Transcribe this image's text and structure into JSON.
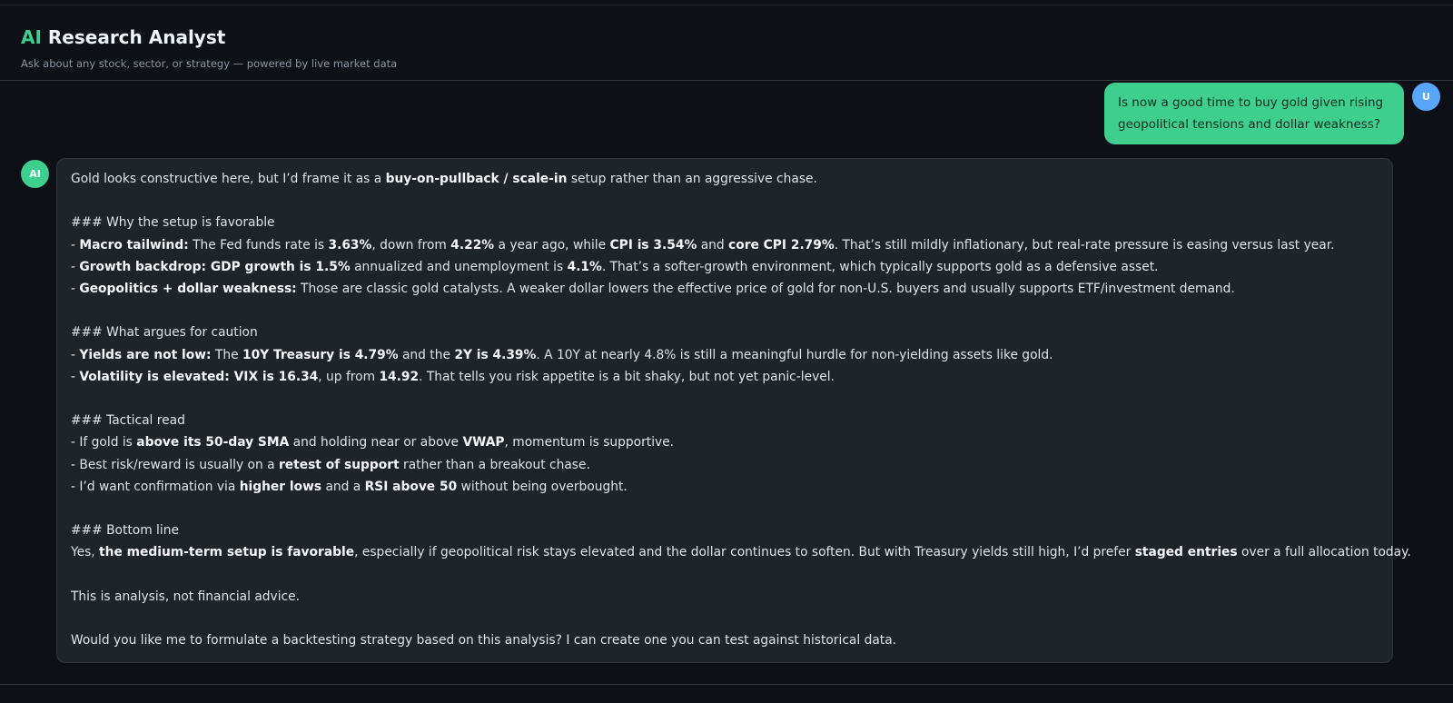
{
  "header": {
    "title_accent": "AI",
    "title_rest": " Research Analyst",
    "subtitle": "Ask about any stock, sector, or strategy — powered by live market data"
  },
  "user_message": {
    "avatar": "U",
    "text": "Is now a good time to buy gold given rising geopolitical tensions and dollar weakness?"
  },
  "ai_message": {
    "avatar": "AI",
    "lines": [
      [
        {
          "t": "Gold looks constructive here, but I’d frame it as a "
        },
        {
          "t": "buy-on-pullback / scale-in",
          "b": true
        },
        {
          "t": " setup rather than an aggressive chase."
        }
      ],
      [],
      [
        {
          "t": "### Why the setup is favorable"
        }
      ],
      [
        {
          "t": "- "
        },
        {
          "t": "Macro tailwind:",
          "b": true
        },
        {
          "t": " The Fed funds rate is "
        },
        {
          "t": "3.63%",
          "b": true
        },
        {
          "t": ", down from "
        },
        {
          "t": "4.22%",
          "b": true
        },
        {
          "t": " a year ago, while "
        },
        {
          "t": "CPI is 3.54%",
          "b": true
        },
        {
          "t": " and "
        },
        {
          "t": "core CPI 2.79%",
          "b": true
        },
        {
          "t": ". That’s still mildly inflationary, but real-rate pressure is easing versus last year."
        }
      ],
      [
        {
          "t": "- "
        },
        {
          "t": "Growth backdrop: GDP growth is 1.5%",
          "b": true
        },
        {
          "t": " annualized and unemployment is "
        },
        {
          "t": "4.1%",
          "b": true
        },
        {
          "t": ". That’s a softer-growth environment, which typically supports gold as a defensive asset."
        }
      ],
      [
        {
          "t": "- "
        },
        {
          "t": "Geopolitics + dollar weakness:",
          "b": true
        },
        {
          "t": " Those are classic gold catalysts. A weaker dollar lowers the effective price of gold for non-U.S. buyers and usually supports ETF/investment demand."
        }
      ],
      [],
      [
        {
          "t": "### What argues for caution"
        }
      ],
      [
        {
          "t": "- "
        },
        {
          "t": "Yields are not low:",
          "b": true
        },
        {
          "t": " The "
        },
        {
          "t": "10Y Treasury is 4.79%",
          "b": true
        },
        {
          "t": " and the "
        },
        {
          "t": "2Y is 4.39%",
          "b": true
        },
        {
          "t": ". A 10Y at nearly 4.8% is still a meaningful hurdle for non-yielding assets like gold."
        }
      ],
      [
        {
          "t": "- "
        },
        {
          "t": "Volatility is elevated: VIX is 16.34",
          "b": true
        },
        {
          "t": ", up from "
        },
        {
          "t": "14.92",
          "b": true
        },
        {
          "t": ". That tells you risk appetite is a bit shaky, but not yet panic-level."
        }
      ],
      [],
      [
        {
          "t": "### Tactical read"
        }
      ],
      [
        {
          "t": "- If gold is "
        },
        {
          "t": "above its 50-day SMA",
          "b": true
        },
        {
          "t": " and holding near or above "
        },
        {
          "t": "VWAP",
          "b": true
        },
        {
          "t": ", momentum is supportive."
        }
      ],
      [
        {
          "t": "- Best risk/reward is usually on a "
        },
        {
          "t": "retest of support",
          "b": true
        },
        {
          "t": " rather than a breakout chase."
        }
      ],
      [
        {
          "t": "- I’d want confirmation via "
        },
        {
          "t": "higher lows",
          "b": true
        },
        {
          "t": " and a "
        },
        {
          "t": "RSI above 50",
          "b": true
        },
        {
          "t": " without being overbought."
        }
      ],
      [],
      [
        {
          "t": "### Bottom line"
        }
      ],
      [
        {
          "t": "Yes, "
        },
        {
          "t": "the medium-term setup is favorable",
          "b": true
        },
        {
          "t": ", especially if geopolitical risk stays elevated and the dollar continues to soften. But with Treasury yields still high, I’d prefer "
        },
        {
          "t": "staged entries",
          "b": true
        },
        {
          "t": " over a full allocation today."
        }
      ],
      [],
      [
        {
          "t": "This is analysis, not financial advice."
        }
      ],
      [],
      [
        {
          "t": "Would you like me to formulate a backtesting strategy based on this analysis? I can create one you can test against historical data."
        }
      ]
    ]
  },
  "colors": {
    "accent": "#3ecf8e",
    "user_avatar": "#58a6ff",
    "background": "#0d1117",
    "bubble": "#1f2428"
  }
}
